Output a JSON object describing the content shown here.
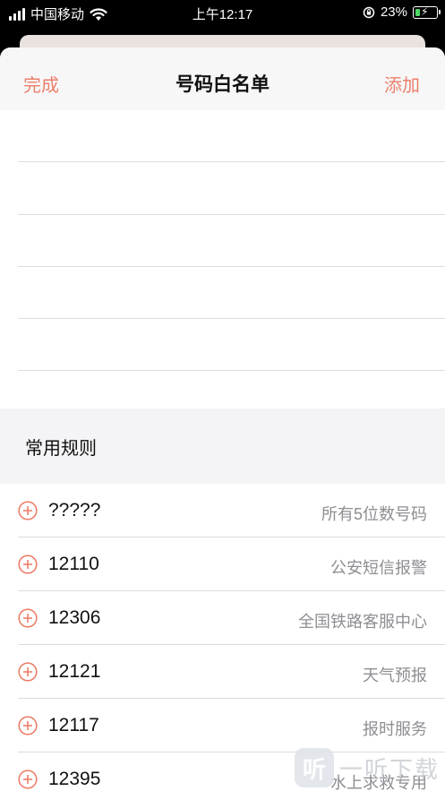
{
  "status_bar": {
    "carrier": "中国移动",
    "time": "上午12:17",
    "battery_percent_label": "23%",
    "battery_level": 0.23
  },
  "nav": {
    "left_label": "完成",
    "title": "号码白名单",
    "right_label": "添加",
    "accent_color": "#ec7f6a"
  },
  "section": {
    "header": "常用规则"
  },
  "rules": [
    {
      "number": "?????",
      "desc": "所有5位数号码"
    },
    {
      "number": "12110",
      "desc": "公安短信报警"
    },
    {
      "number": "12306",
      "desc": "全国铁路客服中心"
    },
    {
      "number": "12121",
      "desc": "天气预报"
    },
    {
      "number": "12117",
      "desc": "报时服务"
    },
    {
      "number": "12395",
      "desc": "水上求救专用"
    }
  ],
  "watermark": {
    "logo_glyph": "听",
    "text": "一听下载"
  },
  "icons": {
    "signal": "signal-bars-icon",
    "wifi": "wifi-icon",
    "orientation_lock": "orientation-lock-icon",
    "battery": "battery-charging-icon",
    "add_rule": "plus-circle-icon"
  }
}
